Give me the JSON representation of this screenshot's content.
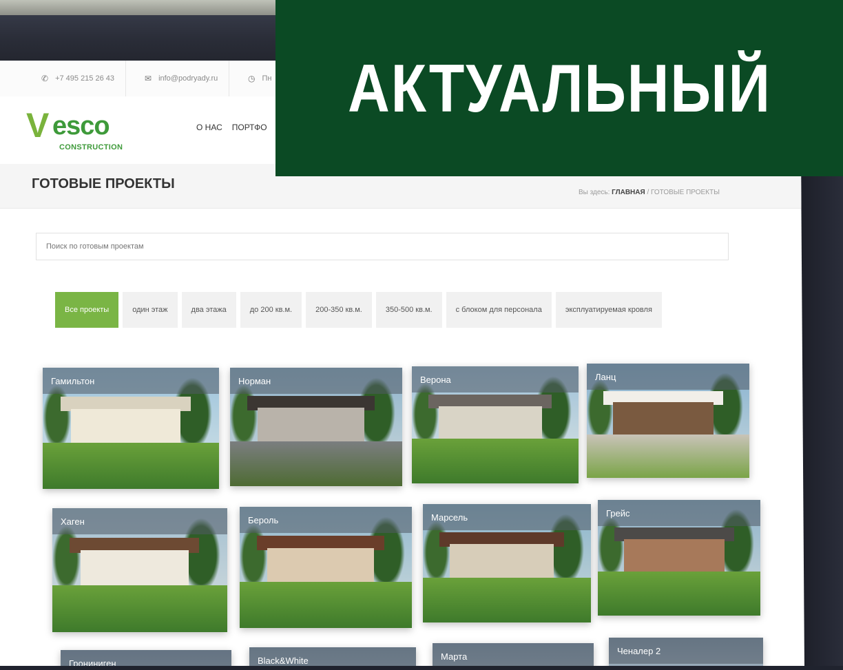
{
  "info": {
    "phone": "+7 495 215 26 43",
    "email": "info@podryady.ru",
    "hours": "Пн"
  },
  "logo": {
    "v": "V",
    "name": "esco",
    "sub": "CONSTRUCTION"
  },
  "nav": [
    "О НАС",
    "ПОРТФО"
  ],
  "title": "ГОТОВЫЕ ПРОЕКТЫ",
  "breadcrumb": {
    "prefix": "Вы здесь:",
    "home": "ГЛАВНАЯ",
    "sep": " / ",
    "current": "ГОТОВЫЕ ПРОЕКТЫ"
  },
  "search": {
    "placeholder": "Поиск по готовым проектам"
  },
  "filters": [
    {
      "label": "Все проекты",
      "active": true
    },
    {
      "label": "один этаж"
    },
    {
      "label": "два этажа"
    },
    {
      "label": "до 200 кв.м."
    },
    {
      "label": "200-350 кв.м."
    },
    {
      "label": "350-500 кв.м."
    },
    {
      "label": "с блоком для персонала"
    },
    {
      "label": "эксплуатируемая кровля"
    }
  ],
  "projects": [
    "Гамильтон",
    "Норман",
    "Верона",
    "Ланц",
    "Хаген",
    "Бероль",
    "Марсель",
    "Грейс",
    "Грониниген",
    "Black&White",
    "Марта",
    "Ченалер 2"
  ],
  "banner": {
    "text": "АКТУАЛЬНЫЙ",
    "color": "#0b4a24"
  },
  "colors": {
    "accent": "#7ab545",
    "logo_green": "#3e9a3a"
  }
}
